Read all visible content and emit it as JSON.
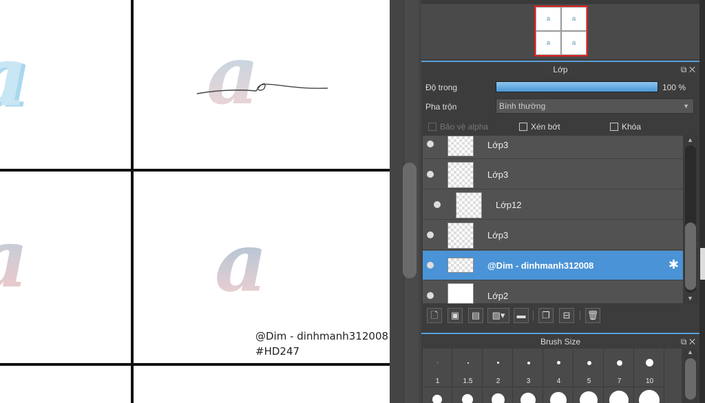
{
  "canvas": {
    "letter": "a",
    "signature_line1": "@Dim - dinhmanh312008",
    "signature_line2": "#HD247",
    "guide_letter": "a"
  },
  "navigator": {
    "thumb_letters": [
      "a",
      "a",
      "a",
      "a"
    ]
  },
  "layer_panel": {
    "title": "Lớp",
    "opacity_label": "Độ trong",
    "opacity_value": "100 %",
    "opacity_fraction": 1.0,
    "blend_label": "Pha trộn",
    "blend_value": "Bình thường",
    "protect_alpha_label": "Bảo vệ alpha",
    "clip_label": "Xén bớt",
    "lock_label": "Khóa",
    "layers": [
      {
        "name": "Lớp3",
        "selected": false
      },
      {
        "name": "Lớp3",
        "selected": false
      },
      {
        "name": "Lớp12",
        "selected": false
      },
      {
        "name": "Lớp3",
        "selected": false
      },
      {
        "name": "@Dim - dinhmanh312008",
        "selected": true
      },
      {
        "name": "Lớp2",
        "selected": false
      }
    ],
    "accent_color": "#4a93d6"
  },
  "brush_panel": {
    "title": "Brush Size",
    "sizes": [
      "1",
      "1.5",
      "2",
      "3",
      "4",
      "5",
      "7",
      "10"
    ]
  },
  "icons": {
    "gear": "✱",
    "popout": "⧉",
    "close": "✕",
    "scroll_up": "▲",
    "scroll_down": "▼",
    "dropdown": "▼"
  }
}
